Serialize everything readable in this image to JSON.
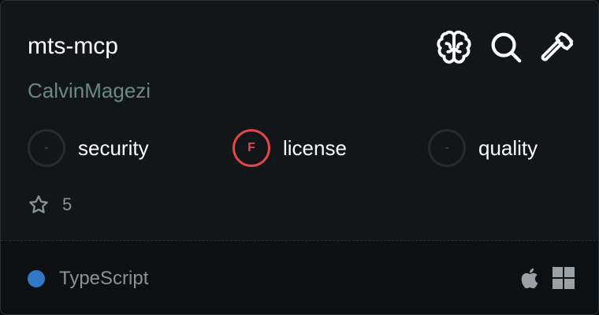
{
  "repo": {
    "name": "mts-mcp",
    "owner": "CalvinMagezi"
  },
  "header_icons": [
    "brain-icon",
    "search-icon",
    "hammer-icon"
  ],
  "scores": [
    {
      "grade": "-",
      "label": "security",
      "status": "none"
    },
    {
      "grade": "F",
      "label": "license",
      "status": "fail"
    },
    {
      "grade": "-",
      "label": "quality",
      "status": "none"
    }
  ],
  "stars": {
    "count": "5"
  },
  "language": {
    "name": "TypeScript",
    "color": "#3178c6"
  },
  "platforms": [
    "apple-icon",
    "windows-icon"
  ],
  "colors": {
    "card_bg": "#121618",
    "owner_text": "#6a8a80",
    "fail_red": "#e0474c",
    "muted_text": "#8b9296"
  }
}
